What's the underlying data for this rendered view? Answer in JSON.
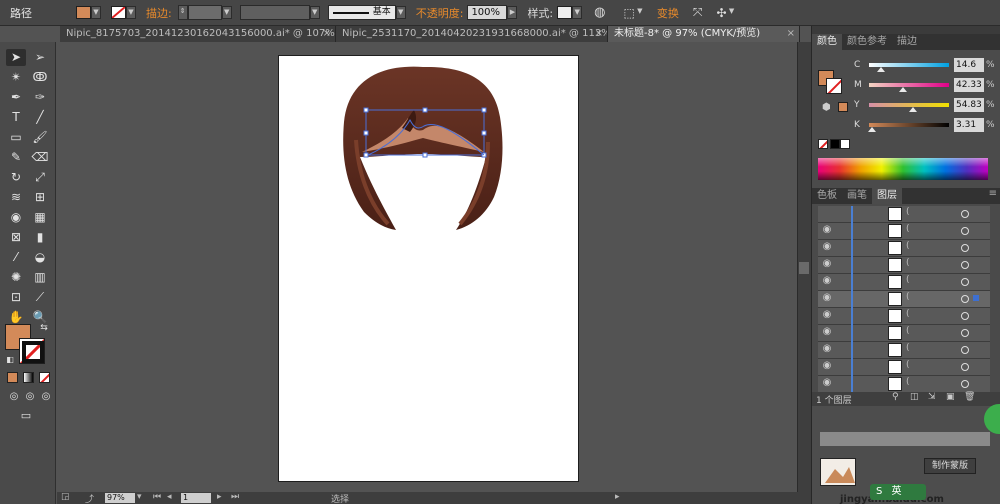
{
  "control_bar": {
    "object_type": "路径",
    "stroke_label": "描边:",
    "stroke_style_label": "基本",
    "opacity_label": "不透明度:",
    "opacity_value": "100%",
    "style_label": "样式:",
    "transform_label": "变换",
    "fill_color": "#d38a59"
  },
  "document_tabs": [
    {
      "title": "Nipic_8175703_20141230162043156000.ai* @ 107% (...",
      "close": "×"
    },
    {
      "title": "Nipic_2531170_20140420231931668000.ai* @ 113% (...",
      "close": "×"
    },
    {
      "title": "未标题-8* @ 97% (CMYK/预览)",
      "close": "×",
      "active": true
    }
  ],
  "color_panel": {
    "tabs": [
      "颜色",
      "颜色参考",
      "描边"
    ],
    "channels": [
      {
        "name": "C",
        "value": "14.6",
        "unit": "%",
        "level": 0.146,
        "gradient": "linear-gradient(90deg,#fff,#00a0e0)"
      },
      {
        "name": "M",
        "value": "42.33",
        "unit": "%",
        "level": 0.423,
        "gradient": "linear-gradient(90deg,#f3d5c2,#e0008a)"
      },
      {
        "name": "Y",
        "value": "54.83",
        "unit": "%",
        "level": 0.548,
        "gradient": "linear-gradient(90deg,#d690a8,#f0e000)"
      },
      {
        "name": "K",
        "value": "3.31",
        "unit": "%",
        "level": 0.033,
        "gradient": "linear-gradient(90deg,#d38a59,#000)"
      }
    ]
  },
  "layers_panel": {
    "tabs": [
      "色板",
      "画笔",
      "图层"
    ],
    "footer_label": "1 个图层",
    "row_labels": [
      "(",
      "(",
      "(",
      "(",
      "(",
      "(",
      "(",
      "(",
      "(",
      "(",
      "("
    ]
  },
  "status_bar": {
    "zoom": "97%",
    "page": "1",
    "selection_label": "选择"
  },
  "watermark": {
    "site": "jingyan.baidu.com",
    "button": "制作蒙版",
    "ime_label": "英"
  }
}
